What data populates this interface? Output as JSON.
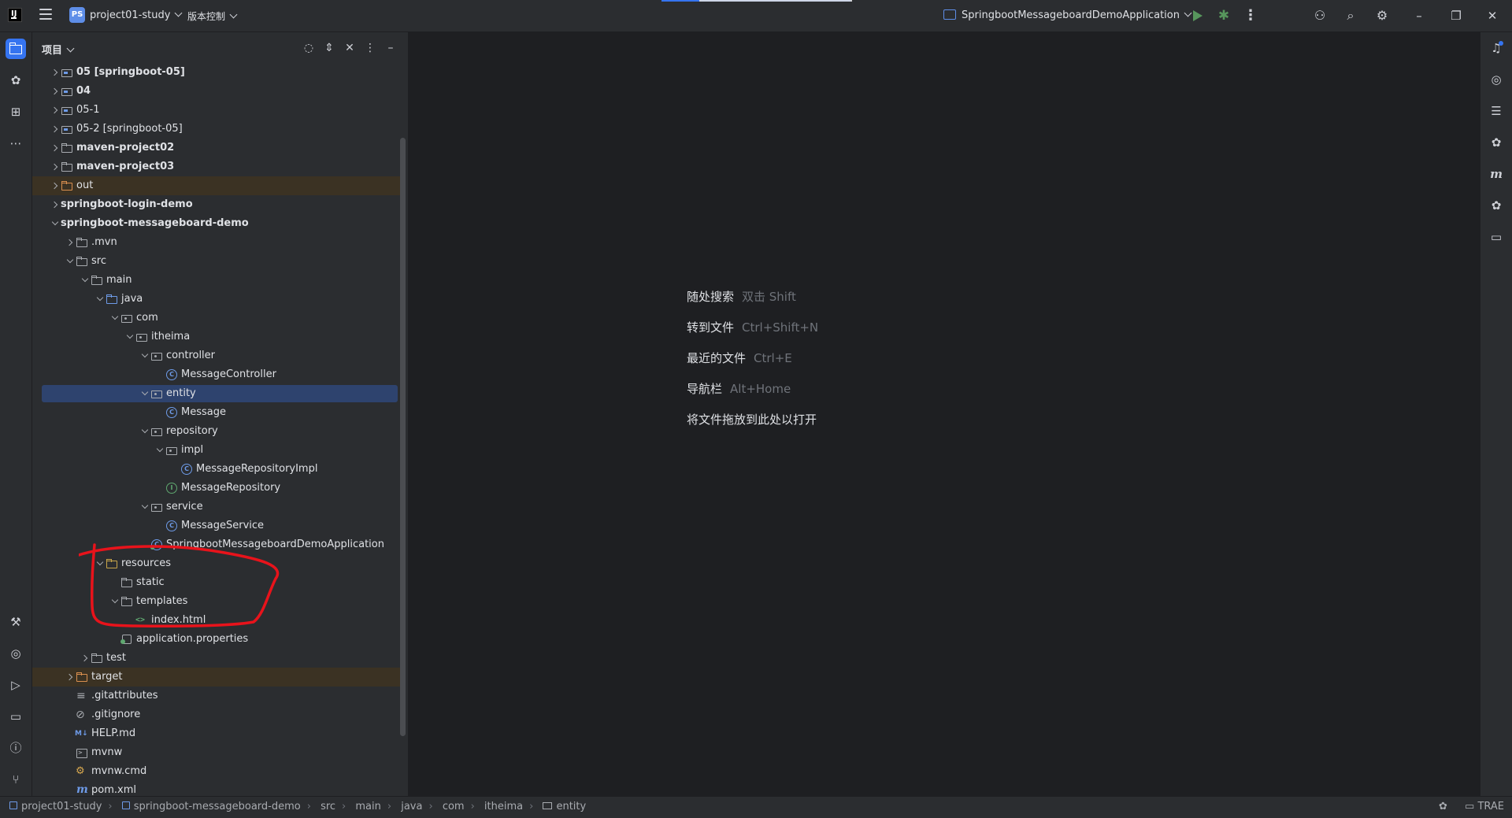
{
  "topbar": {
    "app_logo": "IJ",
    "project_badge": "PS",
    "project_name": "project01-study",
    "vcs_label": "版本控制",
    "run_config": "SpringbootMessageboardDemoApplication",
    "icons": [
      "hamburger-icon",
      "run-icon",
      "debug-icon",
      "more-icon",
      "add-user-icon",
      "search-icon",
      "settings-icon",
      "minimize-icon",
      "restore-icon",
      "close-icon"
    ]
  },
  "project_panel": {
    "title": "项目"
  },
  "tree": [
    {
      "label": "05 [springboot-05]",
      "depth": 0,
      "arrow": "r",
      "icon": "mod",
      "bold": true
    },
    {
      "label": "04",
      "depth": 0,
      "arrow": "r",
      "icon": "mod",
      "bold": true
    },
    {
      "label": "05-1",
      "depth": 0,
      "arrow": "r",
      "icon": "mod",
      "bold": false
    },
    {
      "label": "05-2 [springboot-05]",
      "depth": 0,
      "arrow": "r",
      "icon": "mod",
      "bold": false
    },
    {
      "label": "maven-project02",
      "depth": 0,
      "arrow": "r",
      "icon": "folder",
      "bold": true
    },
    {
      "label": "maven-project03",
      "depth": 0,
      "arrow": "r",
      "icon": "folder",
      "bold": true
    },
    {
      "label": "out",
      "depth": 0,
      "arrow": "r",
      "icon": "folder-orange",
      "bold": false,
      "excluded": true
    },
    {
      "label": "springboot-login-demo",
      "depth": 0,
      "arrow": "r",
      "icon": "none",
      "bold": true
    },
    {
      "label": "springboot-messageboard-demo",
      "depth": 0,
      "arrow": "d",
      "icon": "none",
      "bold": true
    },
    {
      "label": ".mvn",
      "depth": 1,
      "arrow": "r",
      "icon": "folder",
      "bold": false
    },
    {
      "label": "src",
      "depth": 1,
      "arrow": "d",
      "icon": "folder",
      "bold": false
    },
    {
      "label": "main",
      "depth": 2,
      "arrow": "d",
      "icon": "folder",
      "bold": false
    },
    {
      "label": "java",
      "depth": 3,
      "arrow": "d",
      "icon": "folder-blue",
      "bold": false
    },
    {
      "label": "com",
      "depth": 4,
      "arrow": "d",
      "icon": "pkg",
      "bold": false
    },
    {
      "label": "itheima",
      "depth": 5,
      "arrow": "d",
      "icon": "pkg",
      "bold": false
    },
    {
      "label": "controller",
      "depth": 6,
      "arrow": "d",
      "icon": "pkg",
      "bold": false
    },
    {
      "label": "MessageController",
      "depth": 7,
      "arrow": "",
      "icon": "class",
      "bold": false
    },
    {
      "label": "entity",
      "depth": 6,
      "arrow": "d",
      "icon": "pkg",
      "bold": false,
      "selected": true
    },
    {
      "label": "Message",
      "depth": 7,
      "arrow": "",
      "icon": "class",
      "bold": false
    },
    {
      "label": "repository",
      "depth": 6,
      "arrow": "d",
      "icon": "pkg",
      "bold": false
    },
    {
      "label": "impl",
      "depth": 7,
      "arrow": "d",
      "icon": "pkg",
      "bold": false
    },
    {
      "label": "MessageRepositoryImpl",
      "depth": 8,
      "arrow": "",
      "icon": "class",
      "bold": false
    },
    {
      "label": "MessageRepository",
      "depth": 7,
      "arrow": "",
      "icon": "iface",
      "bold": false
    },
    {
      "label": "service",
      "depth": 6,
      "arrow": "d",
      "icon": "pkg",
      "bold": false
    },
    {
      "label": "MessageService",
      "depth": 7,
      "arrow": "",
      "icon": "class",
      "bold": false
    },
    {
      "label": "SpringbootMessageboardDemoApplication",
      "depth": 6,
      "arrow": "",
      "icon": "springcls",
      "bold": false
    },
    {
      "label": "resources",
      "depth": 3,
      "arrow": "d",
      "icon": "folder-yellowish",
      "bold": false
    },
    {
      "label": "static",
      "depth": 4,
      "arrow": "",
      "icon": "folder",
      "bold": false
    },
    {
      "label": "templates",
      "depth": 4,
      "arrow": "d",
      "icon": "folder",
      "bold": false
    },
    {
      "label": "index.html",
      "depth": 5,
      "arrow": "",
      "icon": "html",
      "bold": false
    },
    {
      "label": "application.properties",
      "depth": 4,
      "arrow": "",
      "icon": "props",
      "bold": false
    },
    {
      "label": "test",
      "depth": 2,
      "arrow": "r",
      "icon": "folder",
      "bold": false
    },
    {
      "label": "target",
      "depth": 1,
      "arrow": "r",
      "icon": "folder-orange",
      "bold": false,
      "excluded": true
    },
    {
      "label": ".gitattributes",
      "depth": 1,
      "arrow": "",
      "icon": "lines",
      "bold": false
    },
    {
      "label": ".gitignore",
      "depth": 1,
      "arrow": "",
      "icon": "ignore",
      "bold": false
    },
    {
      "label": "HELP.md",
      "depth": 1,
      "arrow": "",
      "icon": "md",
      "bold": false
    },
    {
      "label": "mvnw",
      "depth": 1,
      "arrow": "",
      "icon": "term",
      "bold": false
    },
    {
      "label": "mvnw.cmd",
      "depth": 1,
      "arrow": "",
      "icon": "cmd",
      "bold": false
    },
    {
      "label": "pom.xml",
      "depth": 1,
      "arrow": "",
      "icon": "maven",
      "bold": false
    }
  ],
  "editor": {
    "hints": [
      {
        "label": "随处搜索",
        "key": "双击 Shift"
      },
      {
        "label": "转到文件",
        "key": "Ctrl+Shift+N"
      },
      {
        "label": "最近的文件",
        "key": "Ctrl+E"
      },
      {
        "label": "导航栏",
        "key": "Alt+Home"
      },
      {
        "label": "将文件拖放到此处以打开",
        "key": ""
      }
    ]
  },
  "statusbar": {
    "breadcrumbs": [
      "project01-study",
      "springboot-messageboard-demo",
      "src",
      "main",
      "java",
      "com",
      "itheima",
      "entity"
    ],
    "right_label": "TRAE"
  },
  "colors": {
    "accent": "#3574f0",
    "annotation": "#e8131b",
    "excluded_bg": "#3b3223",
    "selected_bg": "#2e436e"
  }
}
